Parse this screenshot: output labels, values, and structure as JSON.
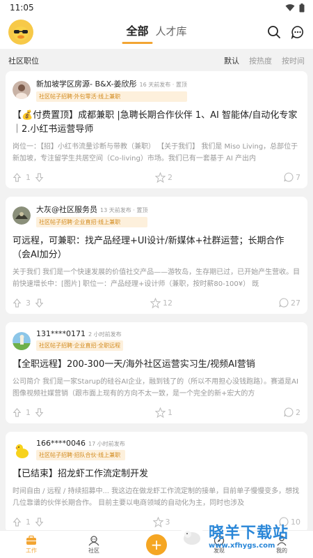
{
  "status": {
    "time": "11:05"
  },
  "header": {
    "tabs": [
      {
        "label": "全部"
      },
      {
        "label": "人才库"
      }
    ]
  },
  "subheader": {
    "title": "社区职位",
    "sorts": [
      {
        "label": "默认"
      },
      {
        "label": "按热度"
      },
      {
        "label": "按时间"
      }
    ]
  },
  "posts": [
    {
      "author": "新加坡学区房源- B&X-姜欣彤",
      "time": "16 天前发布 · 置顶",
      "tag": "社区帖子招聘·外包零活·线上兼职",
      "title": "【💰付费置顶】成都兼职 |急聘长期合作伙伴 1、AI 智能体/自动化专家｜2.小红书运营导师",
      "excerpt": "岗位一：【招】小红书流量诊断与带教（兼职） 【关于我们】 我们是 Miso Living，总部位于新加坡，专注留学生共居空间（Co-living）市场。我们已有一套基于 AI 产出内",
      "up": "1",
      "stars": "2",
      "comments": "7"
    },
    {
      "author": "大灰@社区服务员",
      "time": "13 天前发布 · 置顶",
      "tag": "社区帖子招聘·企业直招·线上兼职",
      "title": "可远程，可兼职：找产品经理+UI设计/新媒体+社群运营；长期合作（会AI加分）",
      "excerpt": "关于我们 我们是一个快速发展的价值社交产品——游牧岛，生存期已过，已开始产生营收。目前快速增长中：[图片] 职位一：产品经理+设计师（兼职，按时薪80-100¥） 既",
      "up": "3",
      "stars": "12",
      "comments": "27"
    },
    {
      "author": "131****0171",
      "time": "2 小时前发布",
      "tag": "社区帖子招聘·企业直招·全职远程",
      "title": "【全职远程】200-300一天/海外社区运营实习生/视频AI营销",
      "excerpt": "公司简介 我们是一家Starup的硅谷AI企业，融到钱了的（所以不用担心没钱跑路）。赛道是AI图像视频社媒营销（跟市面上现有的方向不太一致，是一个完全的新+宏大的方",
      "up": "1",
      "stars": "1",
      "comments": "2"
    },
    {
      "author": "166****0046",
      "time": "17 小时前发布",
      "tag": "社区帖子招聘·招队合伙·线上兼职",
      "title": "【已结束】招龙虾工作流定制开发",
      "excerpt": "时间自由 / 远程 / 持续招募中... 我这边在做龙虾工作流定制的接单，目前单子慢慢变多，想找几位靠谱的伙伴长期合作。 目前主要以电商领域的自动化为主，同时也涉及",
      "up": "1",
      "stars": "3",
      "comments": "10"
    }
  ],
  "nav": [
    {
      "label": "工作"
    },
    {
      "label": "社区"
    },
    {
      "label": "发现"
    },
    {
      "label": "我的"
    }
  ],
  "watermark": {
    "name": "晓羊下载站",
    "url": "www.xfhygs.com"
  },
  "colors": {
    "accent": "#f2a533",
    "tag_text": "#d28a1d",
    "tag_bg": "#fdf0dc"
  }
}
